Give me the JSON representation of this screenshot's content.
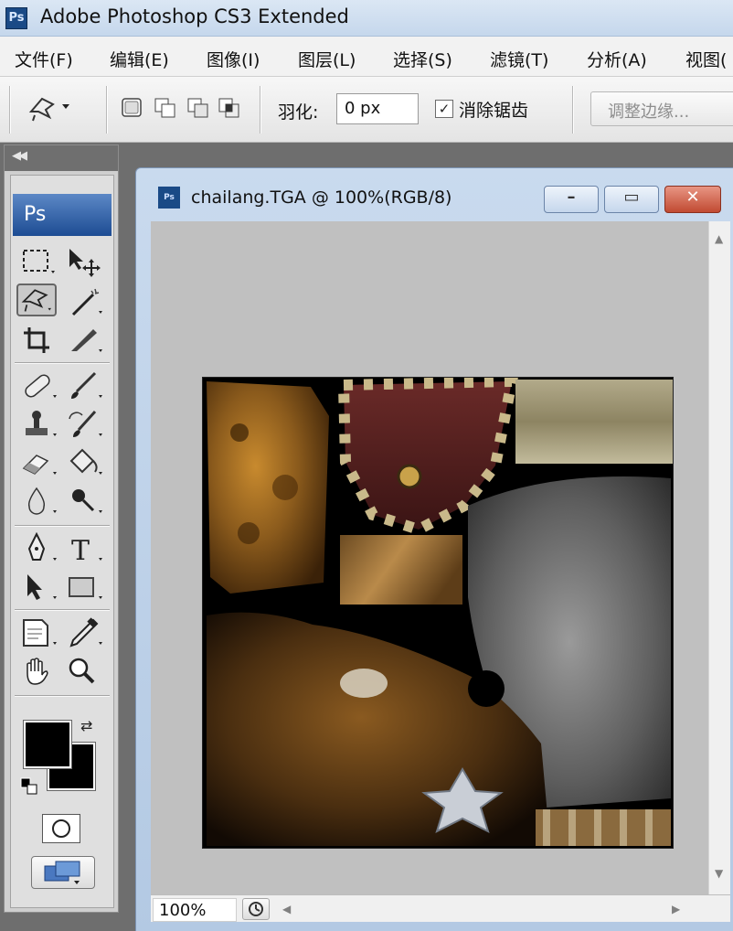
{
  "window": {
    "app_icon_text": "Ps",
    "title": "Adobe Photoshop CS3 Extended"
  },
  "menu": [
    {
      "label": "文件(F)"
    },
    {
      "label": "编辑(E)"
    },
    {
      "label": "图像(I)"
    },
    {
      "label": "图层(L)"
    },
    {
      "label": "选择(S)"
    },
    {
      "label": "滤镜(T)"
    },
    {
      "label": "分析(A)"
    },
    {
      "label": "视图("
    }
  ],
  "options": {
    "current_tool_icon": "polygonal-lasso-icon",
    "selection_modes": [
      "new-selection-icon",
      "add-to-selection-icon",
      "subtract-from-selection-icon",
      "intersect-selection-icon"
    ],
    "feather_label": "羽化:",
    "feather_value": "0 px",
    "antialias_checked": true,
    "antialias_label": "消除锯齿",
    "refine_edge_label": "调整边缘..."
  },
  "tools": {
    "collapse_icon": "collapse-arrows-icon",
    "logo_text": "Ps",
    "items": [
      {
        "icon": "marquee-icon"
      },
      {
        "icon": "move-icon"
      },
      {
        "icon": "lasso-icon",
        "active": true
      },
      {
        "icon": "magic-wand-icon"
      },
      {
        "icon": "crop-icon"
      },
      {
        "icon": "slice-icon"
      },
      {
        "icon": "healing-brush-icon"
      },
      {
        "icon": "brush-icon"
      },
      {
        "icon": "clone-stamp-icon"
      },
      {
        "icon": "history-brush-icon"
      },
      {
        "icon": "eraser-icon"
      },
      {
        "icon": "paint-bucket-icon"
      },
      {
        "icon": "blur-icon"
      },
      {
        "icon": "dodge-icon"
      },
      {
        "icon": "pen-icon"
      },
      {
        "icon": "type-icon",
        "text": "T"
      },
      {
        "icon": "path-selection-icon"
      },
      {
        "icon": "rectangle-shape-icon"
      },
      {
        "icon": "notes-icon"
      },
      {
        "icon": "eyedropper-icon"
      },
      {
        "icon": "hand-icon"
      },
      {
        "icon": "zoom-icon"
      }
    ],
    "foreground_color": "#000000",
    "background_color": "#000000",
    "quick_mask_icon": "quick-mask-icon",
    "screen_mode_icon": "screen-mode-icon"
  },
  "document": {
    "icon_text": "Ps",
    "title": "chailang.TGA @ 100%(RGB/8)",
    "zoom": "100%",
    "canvas_bg": "#c0c0c0"
  }
}
